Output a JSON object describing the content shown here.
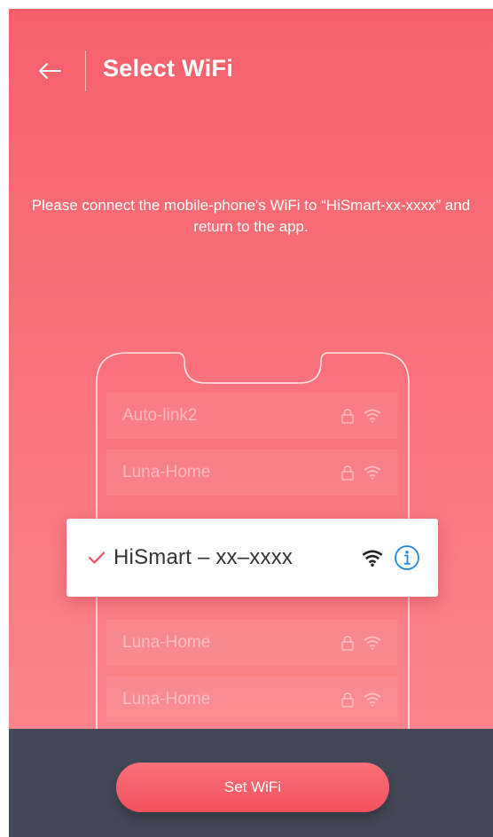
{
  "header": {
    "title": "Select WiFi",
    "back_icon": "arrow-left-icon"
  },
  "instruction": "Please connect the mobile-phone's WiFi to “HiSmart-xx-xxxx” and return to the app.",
  "networks_above": [
    {
      "name": "Auto-link2",
      "locked": true
    },
    {
      "name": "Luna-Home",
      "locked": true
    }
  ],
  "selected_network": {
    "name": "HiSmart – xx–xxxx",
    "check_icon": "checkmark-icon",
    "signal_icon": "wifi-icon",
    "info_icon": "info-icon"
  },
  "networks_below": [
    {
      "name": "Luna-Home",
      "locked": true
    },
    {
      "name": "Luna-Home",
      "locked": true
    }
  ],
  "footer": {
    "button_label": "Set WiFi"
  },
  "colors": {
    "accent": "#f6606b",
    "bottom_bar": "#434957",
    "info_blue": "#1e88e5"
  }
}
